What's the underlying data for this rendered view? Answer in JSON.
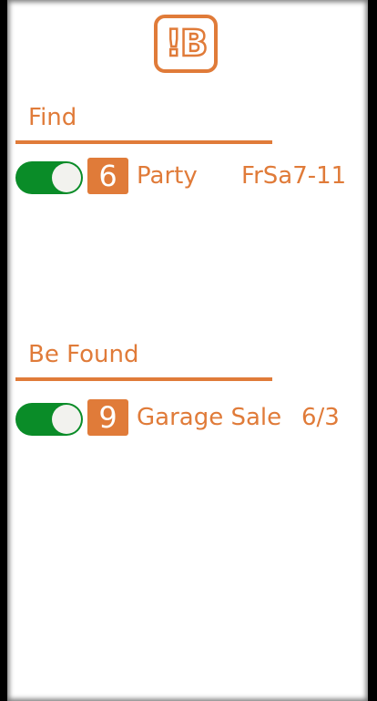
{
  "app": {
    "logo_text": "!B"
  },
  "sections": [
    {
      "title": "Find",
      "items": [
        {
          "enabled": true,
          "count": "6",
          "label": "Party",
          "value": "FrSa7-11"
        }
      ]
    },
    {
      "title": "Be Found",
      "items": [
        {
          "enabled": true,
          "count": "9",
          "label": "Garage Sale",
          "value": "6/3"
        }
      ]
    }
  ],
  "colors": {
    "accent": "#E07B39",
    "toggle_on": "#0A8C28",
    "background": "#FFFFFF",
    "frame": "#000000"
  },
  "icons": {
    "logo": "exclamation-b-logo-icon",
    "toggle": "toggle-switch-icon"
  }
}
